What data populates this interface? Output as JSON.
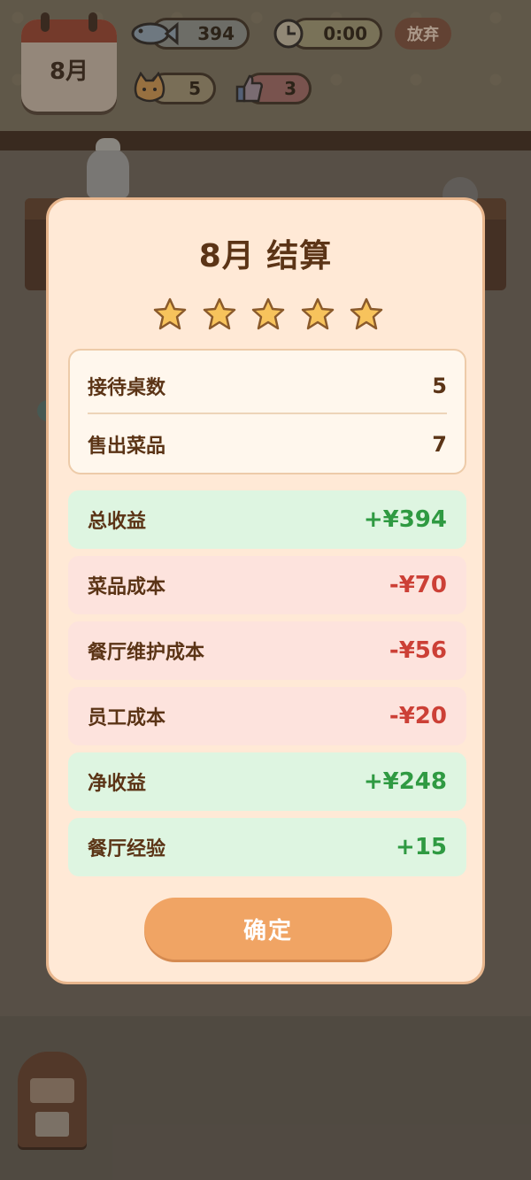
{
  "hud": {
    "calendar_month": "8月",
    "money": "394",
    "time": "0:00",
    "cats": "5",
    "likes": "3",
    "give_up_label": "放弃"
  },
  "dialog": {
    "title": "8月 结算",
    "stars_rating": 5,
    "stars_total": 5,
    "summary": [
      {
        "label": "接待桌数",
        "value": "5"
      },
      {
        "label": "售出菜品",
        "value": "7"
      }
    ],
    "rows": [
      {
        "label": "总收益",
        "value": "+¥394",
        "kind": "positive"
      },
      {
        "label": "菜品成本",
        "value": "-¥70",
        "kind": "negative"
      },
      {
        "label": "餐厅维护成本",
        "value": "-¥56",
        "kind": "negative"
      },
      {
        "label": "员工成本",
        "value": "-¥20",
        "kind": "negative"
      },
      {
        "label": "净收益",
        "value": "+¥248",
        "kind": "positive"
      },
      {
        "label": "餐厅经验",
        "value": "+15",
        "kind": "positive"
      }
    ],
    "confirm_label": "确定"
  },
  "colors": {
    "dialog_bg": "#ffe9d6",
    "positive": "#2f9a42",
    "negative": "#cc4036",
    "button": "#f0a464",
    "star": "#f7c35c"
  }
}
